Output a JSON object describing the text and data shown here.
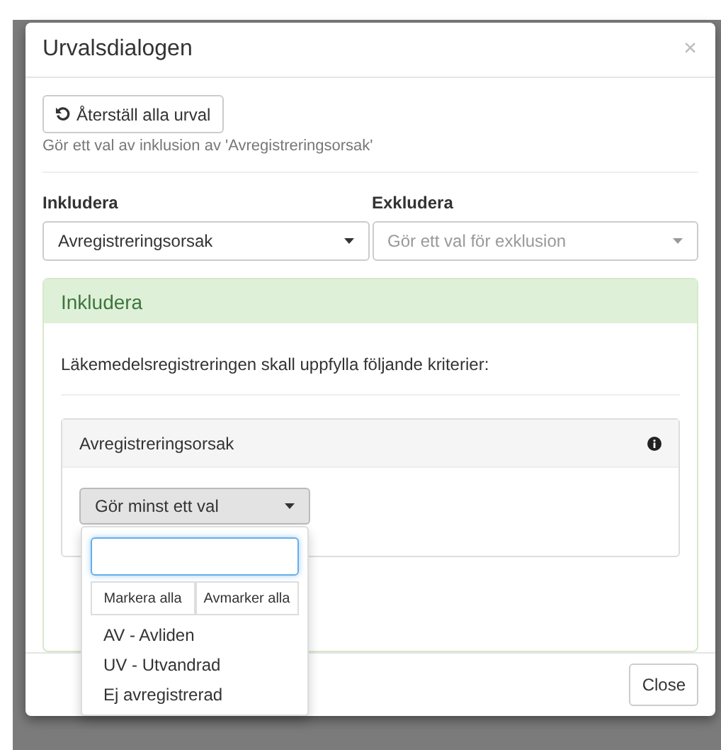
{
  "dialog": {
    "title": "Urvalsdialogen",
    "close_icon": "×",
    "reset_button": "Återställ alla urval",
    "hint": "Gör ett val av inklusion av 'Avregistreringsorsak'",
    "include": {
      "label": "Inkludera",
      "value": "Avregistreringsorsak"
    },
    "exclude": {
      "label": "Exkludera",
      "placeholder": "Gör ett val för exklusion"
    },
    "panel": {
      "title": "Inkludera",
      "text": "Läkemedelsregistreringen skall uppfylla följande kriterier:",
      "criterion": {
        "title": "Avregistreringsorsak",
        "dropdown": {
          "label": "Gör minst ett val",
          "expanded": true,
          "select_all": "Markera alla",
          "deselect_all": "Avmarker alla",
          "options": [
            "AV - Avliden",
            "UV - Utvandrad",
            "Ej avregistrerad"
          ]
        }
      }
    },
    "footer_button": "Close"
  }
}
